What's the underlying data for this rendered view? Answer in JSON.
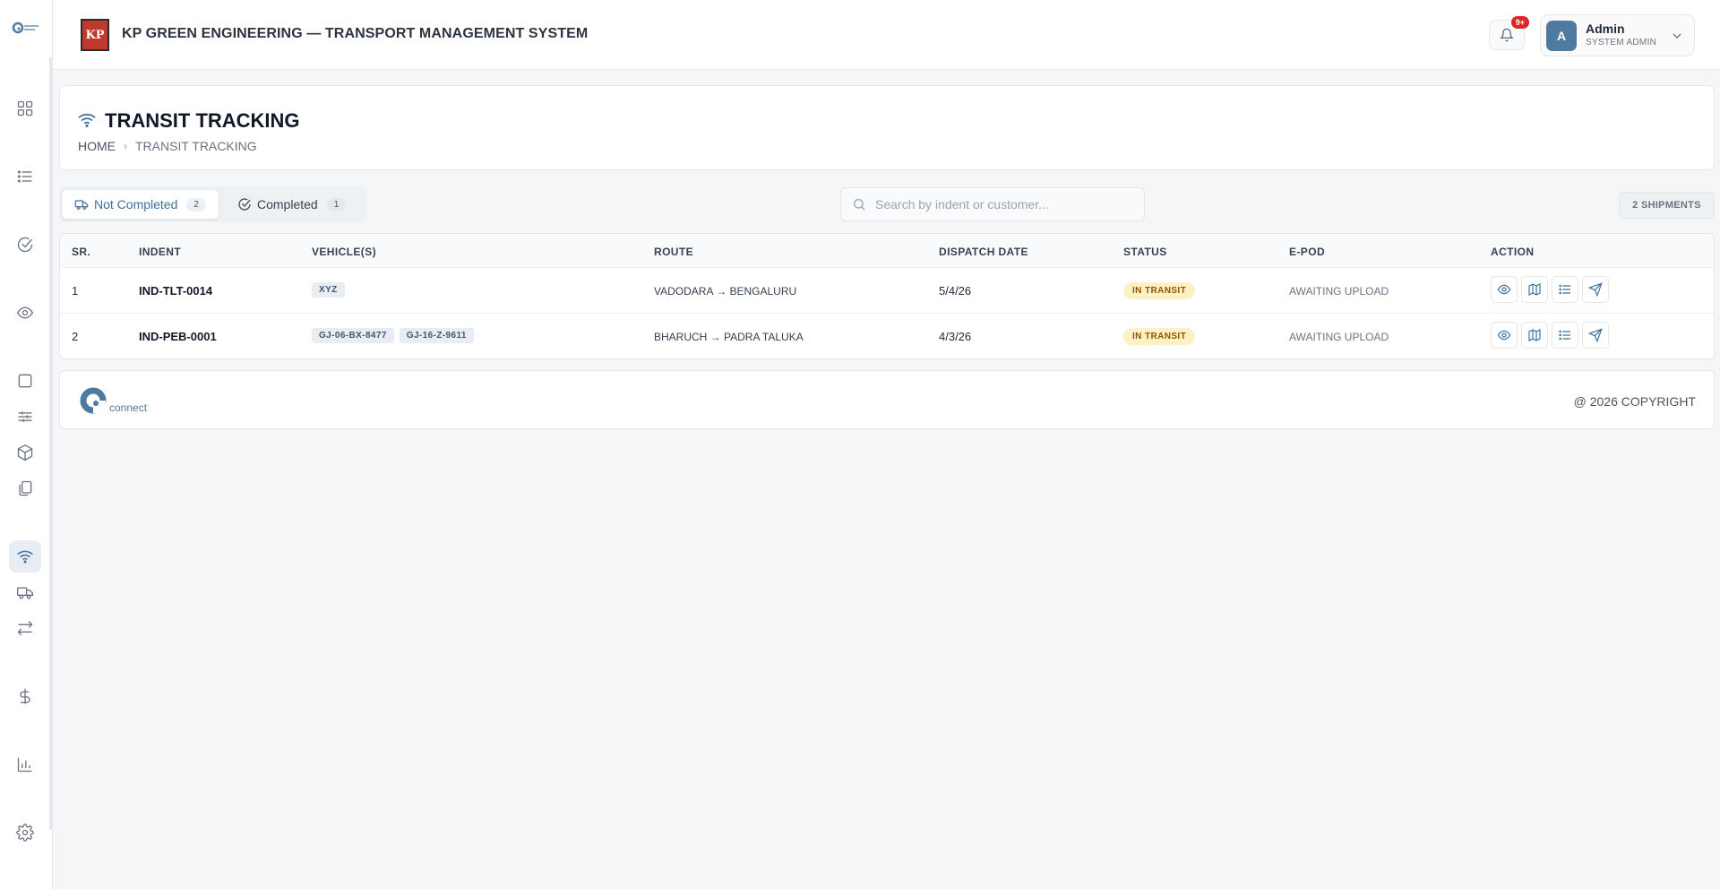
{
  "header": {
    "title": "KP GREEN ENGINEERING — TRANSPORT MANAGEMENT SYSTEM",
    "brand_logo_text": "KP",
    "notification_count": "9+",
    "user": {
      "initial": "A",
      "name": "Admin",
      "role": "SYSTEM ADMIN"
    }
  },
  "sidebar": {
    "items": [
      {
        "icon": "dashboard-grid-icon"
      },
      {
        "icon": "list-icon"
      },
      {
        "icon": "check-circle-icon"
      },
      {
        "icon": "eye-icon"
      },
      {
        "icon": "square-icon"
      },
      {
        "icon": "sliders-icon"
      },
      {
        "icon": "package-icon"
      },
      {
        "icon": "documents-icon"
      },
      {
        "icon": "wifi-icon",
        "active": true
      },
      {
        "icon": "truck-icon"
      },
      {
        "icon": "transfer-arrows-icon"
      },
      {
        "icon": "dollar-icon"
      },
      {
        "icon": "bar-chart-icon"
      },
      {
        "icon": "settings-icon"
      }
    ]
  },
  "page": {
    "title": "TRANSIT TRACKING",
    "breadcrumb": {
      "home": "HOME",
      "current": "TRANSIT TRACKING"
    }
  },
  "toolbar": {
    "tabs": [
      {
        "label": "Not Completed",
        "count": "2",
        "active": true
      },
      {
        "label": "Completed",
        "count": "1",
        "active": false
      }
    ],
    "search_placeholder": "Search by indent or customer...",
    "shipment_count": "2 SHIPMENTS"
  },
  "table": {
    "columns": [
      "SR.",
      "INDENT",
      "VEHICLE(S)",
      "ROUTE",
      "DISPATCH DATE",
      "STATUS",
      "E-POD",
      "ACTION"
    ],
    "rows": [
      {
        "sr": "1",
        "indent": "IND-TLT-0014",
        "vehicles": [
          "XYZ"
        ],
        "route": "VADODARA → BENGALURU",
        "dispatch_date": "5/4/26",
        "status": "IN TRANSIT",
        "epod": "AWAITING UPLOAD"
      },
      {
        "sr": "2",
        "indent": "IND-PEB-0001",
        "vehicles": [
          "GJ-06-BX-8477",
          "GJ-16-Z-9611"
        ],
        "route": "BHARUCH → PADRA TALUKA",
        "dispatch_date": "4/3/26",
        "status": "IN TRANSIT",
        "epod": "AWAITING UPLOAD"
      }
    ]
  },
  "footer": {
    "logo_text": "connect",
    "copyright": "@ 2026 COPYRIGHT"
  },
  "colors": {
    "accent": "#3f6f99",
    "status_bg": "#fdf0c2",
    "status_text": "#8a5a00",
    "badge": "#dc2626"
  }
}
